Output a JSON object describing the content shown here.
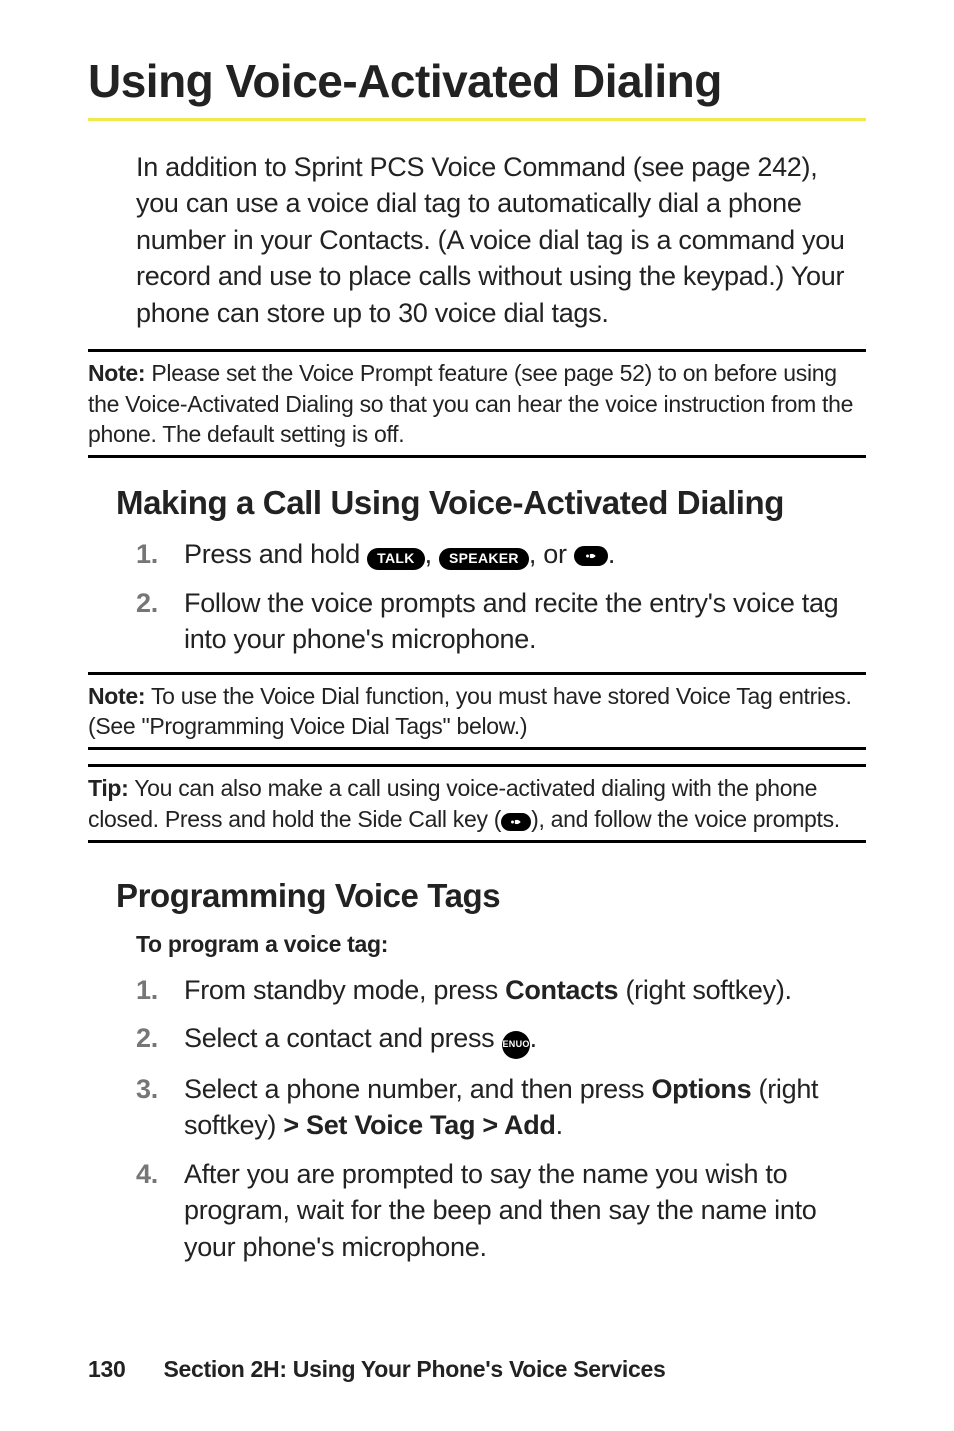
{
  "title": "Using Voice-Activated Dialing",
  "intro": "In addition to Sprint PCS Voice Command (see page 242), you can use a voice dial tag to automatically dial a phone number in your Contacts. (A voice dial tag is a command you record and use to place calls without using the keypad.) Your phone can store up to 30 voice dial tags.",
  "note1": {
    "label": "Note:",
    "text": " Please set the Voice Prompt feature (see page 52) to on before using the Voice-Activated Dialing so that you can hear the voice instruction from the phone. The default setting is off."
  },
  "section1": {
    "heading": "Making a Call Using Voice-Activated Dialing",
    "steps": [
      {
        "num": "1.",
        "prefix": "Press and hold ",
        "key1": "TALK",
        "sep1": ", ",
        "key2": "SPEAKER",
        "sep2": ", or ",
        "key3_icon": "side-call",
        "suffix": "."
      },
      {
        "num": "2.",
        "text": "Follow the voice prompts and recite the entry's voice tag into your phone's microphone."
      }
    ]
  },
  "note2": {
    "label": "Note:",
    "text": " To use the Voice Dial function, you must have stored Voice Tag entries. (See \"Programming Voice Dial Tags\" below.)"
  },
  "tip": {
    "label": "Tip:",
    "text_before": " You can also make a call using voice-activated dialing with the phone closed. Press and hold the Side Call key (",
    "text_after": "), and follow the voice prompts."
  },
  "section2": {
    "heading": "Programming Voice Tags",
    "subhead": "To program a voice tag:",
    "steps": [
      {
        "num": "1.",
        "before": "From standby mode, press ",
        "bold": "Contacts",
        "after": " (right softkey)."
      },
      {
        "num": "2.",
        "before": "Select a contact and press ",
        "key_icon": "menu-ok",
        "after": "."
      },
      {
        "num": "3.",
        "before": "Select a phone number, and then press ",
        "bold1": "Options",
        "mid": " (right softkey) ",
        "bold2": "> Set Voice Tag > Add",
        "after": "."
      },
      {
        "num": "4.",
        "text": "After you are prompted to say the name you wish to program, wait for the beep and then say the name into your phone's microphone."
      }
    ]
  },
  "footer": {
    "page": "130",
    "section": "Section 2H: Using Your Phone's Voice Services"
  },
  "icons": {
    "menu_ok_top": "MENU",
    "menu_ok_bottom": "OK"
  }
}
